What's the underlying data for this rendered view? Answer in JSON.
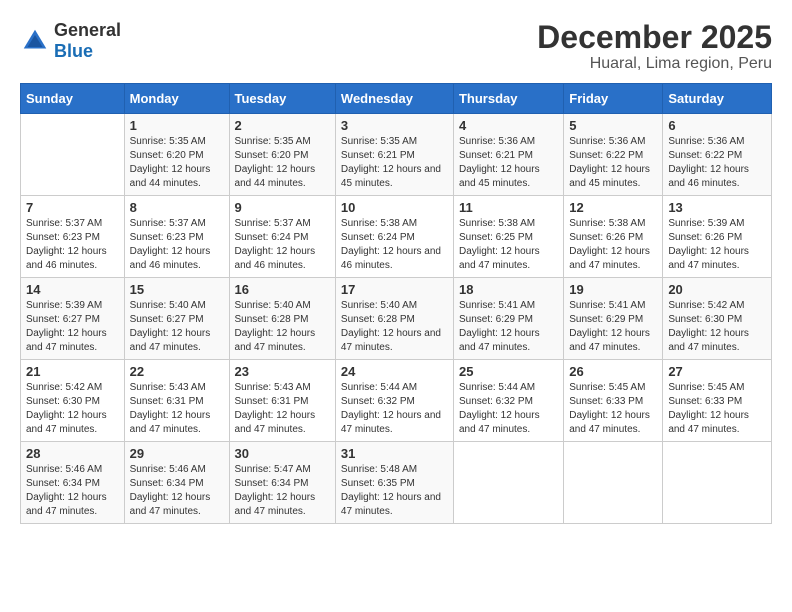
{
  "logo": {
    "general": "General",
    "blue": "Blue"
  },
  "title": "December 2025",
  "subtitle": "Huaral, Lima region, Peru",
  "days_of_week": [
    "Sunday",
    "Monday",
    "Tuesday",
    "Wednesday",
    "Thursday",
    "Friday",
    "Saturday"
  ],
  "weeks": [
    [
      {
        "day": "",
        "sunrise": "",
        "sunset": "",
        "daylight": ""
      },
      {
        "day": "1",
        "sunrise": "Sunrise: 5:35 AM",
        "sunset": "Sunset: 6:20 PM",
        "daylight": "Daylight: 12 hours and 44 minutes."
      },
      {
        "day": "2",
        "sunrise": "Sunrise: 5:35 AM",
        "sunset": "Sunset: 6:20 PM",
        "daylight": "Daylight: 12 hours and 44 minutes."
      },
      {
        "day": "3",
        "sunrise": "Sunrise: 5:35 AM",
        "sunset": "Sunset: 6:21 PM",
        "daylight": "Daylight: 12 hours and 45 minutes."
      },
      {
        "day": "4",
        "sunrise": "Sunrise: 5:36 AM",
        "sunset": "Sunset: 6:21 PM",
        "daylight": "Daylight: 12 hours and 45 minutes."
      },
      {
        "day": "5",
        "sunrise": "Sunrise: 5:36 AM",
        "sunset": "Sunset: 6:22 PM",
        "daylight": "Daylight: 12 hours and 45 minutes."
      },
      {
        "day": "6",
        "sunrise": "Sunrise: 5:36 AM",
        "sunset": "Sunset: 6:22 PM",
        "daylight": "Daylight: 12 hours and 46 minutes."
      }
    ],
    [
      {
        "day": "7",
        "sunrise": "Sunrise: 5:37 AM",
        "sunset": "Sunset: 6:23 PM",
        "daylight": "Daylight: 12 hours and 46 minutes."
      },
      {
        "day": "8",
        "sunrise": "Sunrise: 5:37 AM",
        "sunset": "Sunset: 6:23 PM",
        "daylight": "Daylight: 12 hours and 46 minutes."
      },
      {
        "day": "9",
        "sunrise": "Sunrise: 5:37 AM",
        "sunset": "Sunset: 6:24 PM",
        "daylight": "Daylight: 12 hours and 46 minutes."
      },
      {
        "day": "10",
        "sunrise": "Sunrise: 5:38 AM",
        "sunset": "Sunset: 6:24 PM",
        "daylight": "Daylight: 12 hours and 46 minutes."
      },
      {
        "day": "11",
        "sunrise": "Sunrise: 5:38 AM",
        "sunset": "Sunset: 6:25 PM",
        "daylight": "Daylight: 12 hours and 47 minutes."
      },
      {
        "day": "12",
        "sunrise": "Sunrise: 5:38 AM",
        "sunset": "Sunset: 6:26 PM",
        "daylight": "Daylight: 12 hours and 47 minutes."
      },
      {
        "day": "13",
        "sunrise": "Sunrise: 5:39 AM",
        "sunset": "Sunset: 6:26 PM",
        "daylight": "Daylight: 12 hours and 47 minutes."
      }
    ],
    [
      {
        "day": "14",
        "sunrise": "Sunrise: 5:39 AM",
        "sunset": "Sunset: 6:27 PM",
        "daylight": "Daylight: 12 hours and 47 minutes."
      },
      {
        "day": "15",
        "sunrise": "Sunrise: 5:40 AM",
        "sunset": "Sunset: 6:27 PM",
        "daylight": "Daylight: 12 hours and 47 minutes."
      },
      {
        "day": "16",
        "sunrise": "Sunrise: 5:40 AM",
        "sunset": "Sunset: 6:28 PM",
        "daylight": "Daylight: 12 hours and 47 minutes."
      },
      {
        "day": "17",
        "sunrise": "Sunrise: 5:40 AM",
        "sunset": "Sunset: 6:28 PM",
        "daylight": "Daylight: 12 hours and 47 minutes."
      },
      {
        "day": "18",
        "sunrise": "Sunrise: 5:41 AM",
        "sunset": "Sunset: 6:29 PM",
        "daylight": "Daylight: 12 hours and 47 minutes."
      },
      {
        "day": "19",
        "sunrise": "Sunrise: 5:41 AM",
        "sunset": "Sunset: 6:29 PM",
        "daylight": "Daylight: 12 hours and 47 minutes."
      },
      {
        "day": "20",
        "sunrise": "Sunrise: 5:42 AM",
        "sunset": "Sunset: 6:30 PM",
        "daylight": "Daylight: 12 hours and 47 minutes."
      }
    ],
    [
      {
        "day": "21",
        "sunrise": "Sunrise: 5:42 AM",
        "sunset": "Sunset: 6:30 PM",
        "daylight": "Daylight: 12 hours and 47 minutes."
      },
      {
        "day": "22",
        "sunrise": "Sunrise: 5:43 AM",
        "sunset": "Sunset: 6:31 PM",
        "daylight": "Daylight: 12 hours and 47 minutes."
      },
      {
        "day": "23",
        "sunrise": "Sunrise: 5:43 AM",
        "sunset": "Sunset: 6:31 PM",
        "daylight": "Daylight: 12 hours and 47 minutes."
      },
      {
        "day": "24",
        "sunrise": "Sunrise: 5:44 AM",
        "sunset": "Sunset: 6:32 PM",
        "daylight": "Daylight: 12 hours and 47 minutes."
      },
      {
        "day": "25",
        "sunrise": "Sunrise: 5:44 AM",
        "sunset": "Sunset: 6:32 PM",
        "daylight": "Daylight: 12 hours and 47 minutes."
      },
      {
        "day": "26",
        "sunrise": "Sunrise: 5:45 AM",
        "sunset": "Sunset: 6:33 PM",
        "daylight": "Daylight: 12 hours and 47 minutes."
      },
      {
        "day": "27",
        "sunrise": "Sunrise: 5:45 AM",
        "sunset": "Sunset: 6:33 PM",
        "daylight": "Daylight: 12 hours and 47 minutes."
      }
    ],
    [
      {
        "day": "28",
        "sunrise": "Sunrise: 5:46 AM",
        "sunset": "Sunset: 6:34 PM",
        "daylight": "Daylight: 12 hours and 47 minutes."
      },
      {
        "day": "29",
        "sunrise": "Sunrise: 5:46 AM",
        "sunset": "Sunset: 6:34 PM",
        "daylight": "Daylight: 12 hours and 47 minutes."
      },
      {
        "day": "30",
        "sunrise": "Sunrise: 5:47 AM",
        "sunset": "Sunset: 6:34 PM",
        "daylight": "Daylight: 12 hours and 47 minutes."
      },
      {
        "day": "31",
        "sunrise": "Sunrise: 5:48 AM",
        "sunset": "Sunset: 6:35 PM",
        "daylight": "Daylight: 12 hours and 47 minutes."
      },
      {
        "day": "",
        "sunrise": "",
        "sunset": "",
        "daylight": ""
      },
      {
        "day": "",
        "sunrise": "",
        "sunset": "",
        "daylight": ""
      },
      {
        "day": "",
        "sunrise": "",
        "sunset": "",
        "daylight": ""
      }
    ]
  ]
}
